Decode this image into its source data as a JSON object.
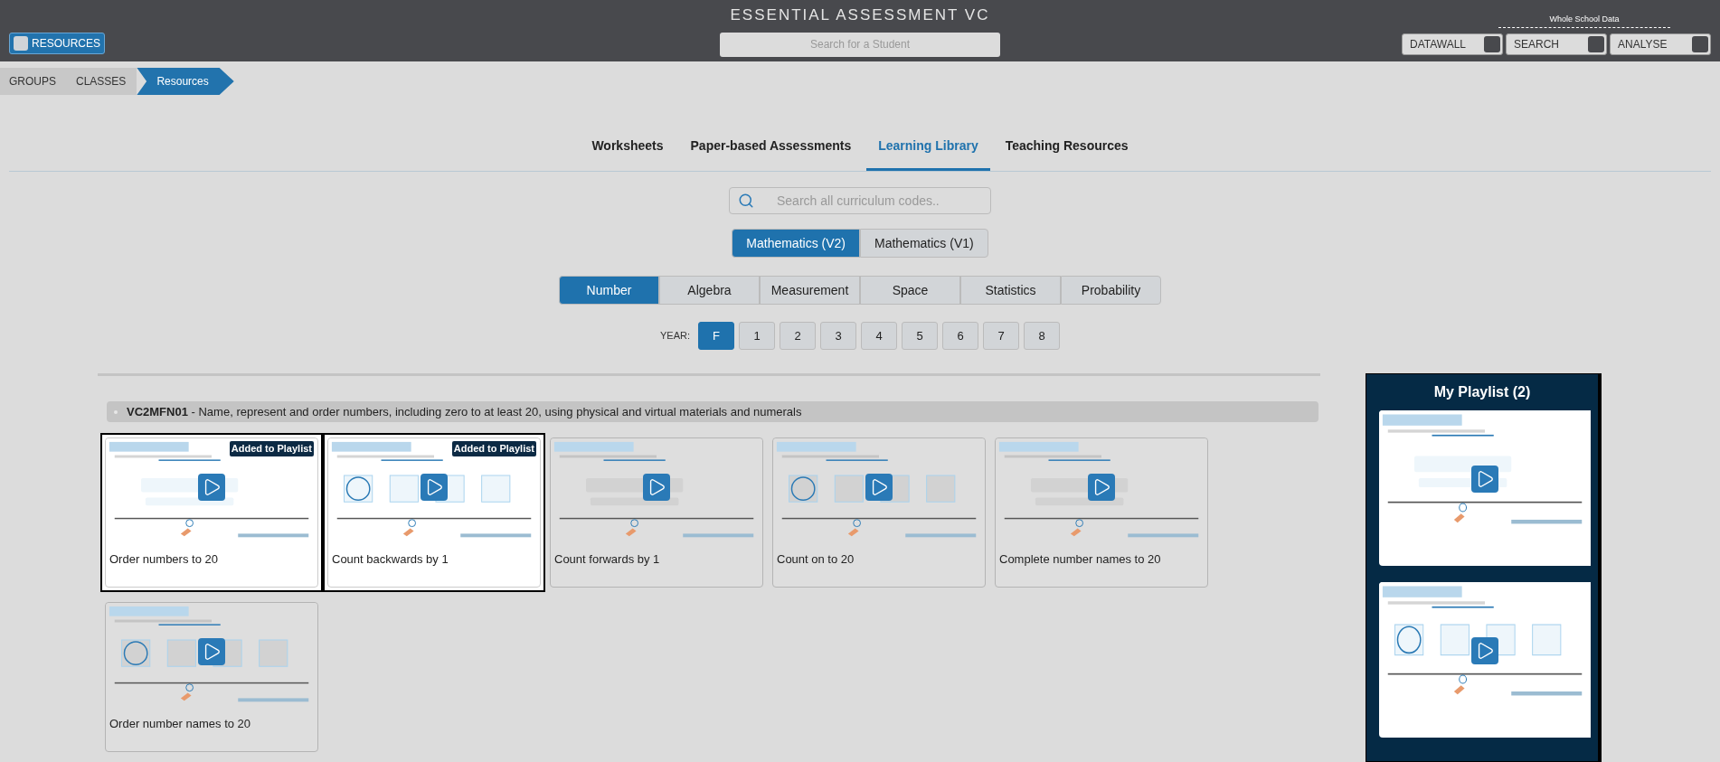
{
  "header": {
    "title": "ESSENTIAL ASSESSMENT VC",
    "resources_button": "RESOURCES",
    "student_search": {
      "placeholder": "Search for a Student"
    },
    "whole_school_label": "Whole School Data",
    "nav_buttons": [
      "DATAWALL",
      "SEARCH",
      "ANALYSE"
    ]
  },
  "breadcrumbs": [
    {
      "label": "GROUPS",
      "selected": false
    },
    {
      "label": "CLASSES",
      "selected": false
    },
    {
      "label": "Resources",
      "selected": true
    }
  ],
  "tabs": [
    {
      "label": "Worksheets",
      "selected": false
    },
    {
      "label": "Paper-based Assessments",
      "selected": false
    },
    {
      "label": "Learning Library",
      "selected": true
    },
    {
      "label": "Teaching Resources",
      "selected": false
    }
  ],
  "curriculum_search": {
    "placeholder": "Search all curriculum codes.."
  },
  "subjects": [
    {
      "label": "Mathematics (V2)",
      "selected": true
    },
    {
      "label": "Mathematics (V1)",
      "selected": false
    }
  ],
  "strands": [
    {
      "label": "Number",
      "selected": true
    },
    {
      "label": "Algebra",
      "selected": false
    },
    {
      "label": "Measurement",
      "selected": false
    },
    {
      "label": "Space",
      "selected": false
    },
    {
      "label": "Statistics",
      "selected": false
    },
    {
      "label": "Probability",
      "selected": false
    }
  ],
  "year_label": "YEAR:",
  "years": [
    {
      "label": "F",
      "selected": true
    },
    {
      "label": "1",
      "selected": false
    },
    {
      "label": "2",
      "selected": false
    },
    {
      "label": "3",
      "selected": false
    },
    {
      "label": "4",
      "selected": false
    },
    {
      "label": "5",
      "selected": false
    },
    {
      "label": "6",
      "selected": false
    },
    {
      "label": "7",
      "selected": false
    },
    {
      "label": "8",
      "selected": false
    }
  ],
  "section": {
    "heading": "**VC2MFN01** - Name, represent and order numbers, including zero to at least 20, using physical and virtual materials and numerals"
  },
  "cards": [
    {
      "title": "Order numbers to 20",
      "added": true,
      "badge": "Added to Playlist"
    },
    {
      "title": "Count backwards by 1",
      "added": true,
      "badge": "Added to Playlist"
    },
    {
      "title": "Count forwards by 1",
      "added": false
    },
    {
      "title": "Count on to 20",
      "added": false
    },
    {
      "title": "Complete number names to 20",
      "added": false
    },
    {
      "title": "Order number names to 20",
      "added": false
    }
  ],
  "playlist": {
    "title": "My Playlist (2)"
  }
}
